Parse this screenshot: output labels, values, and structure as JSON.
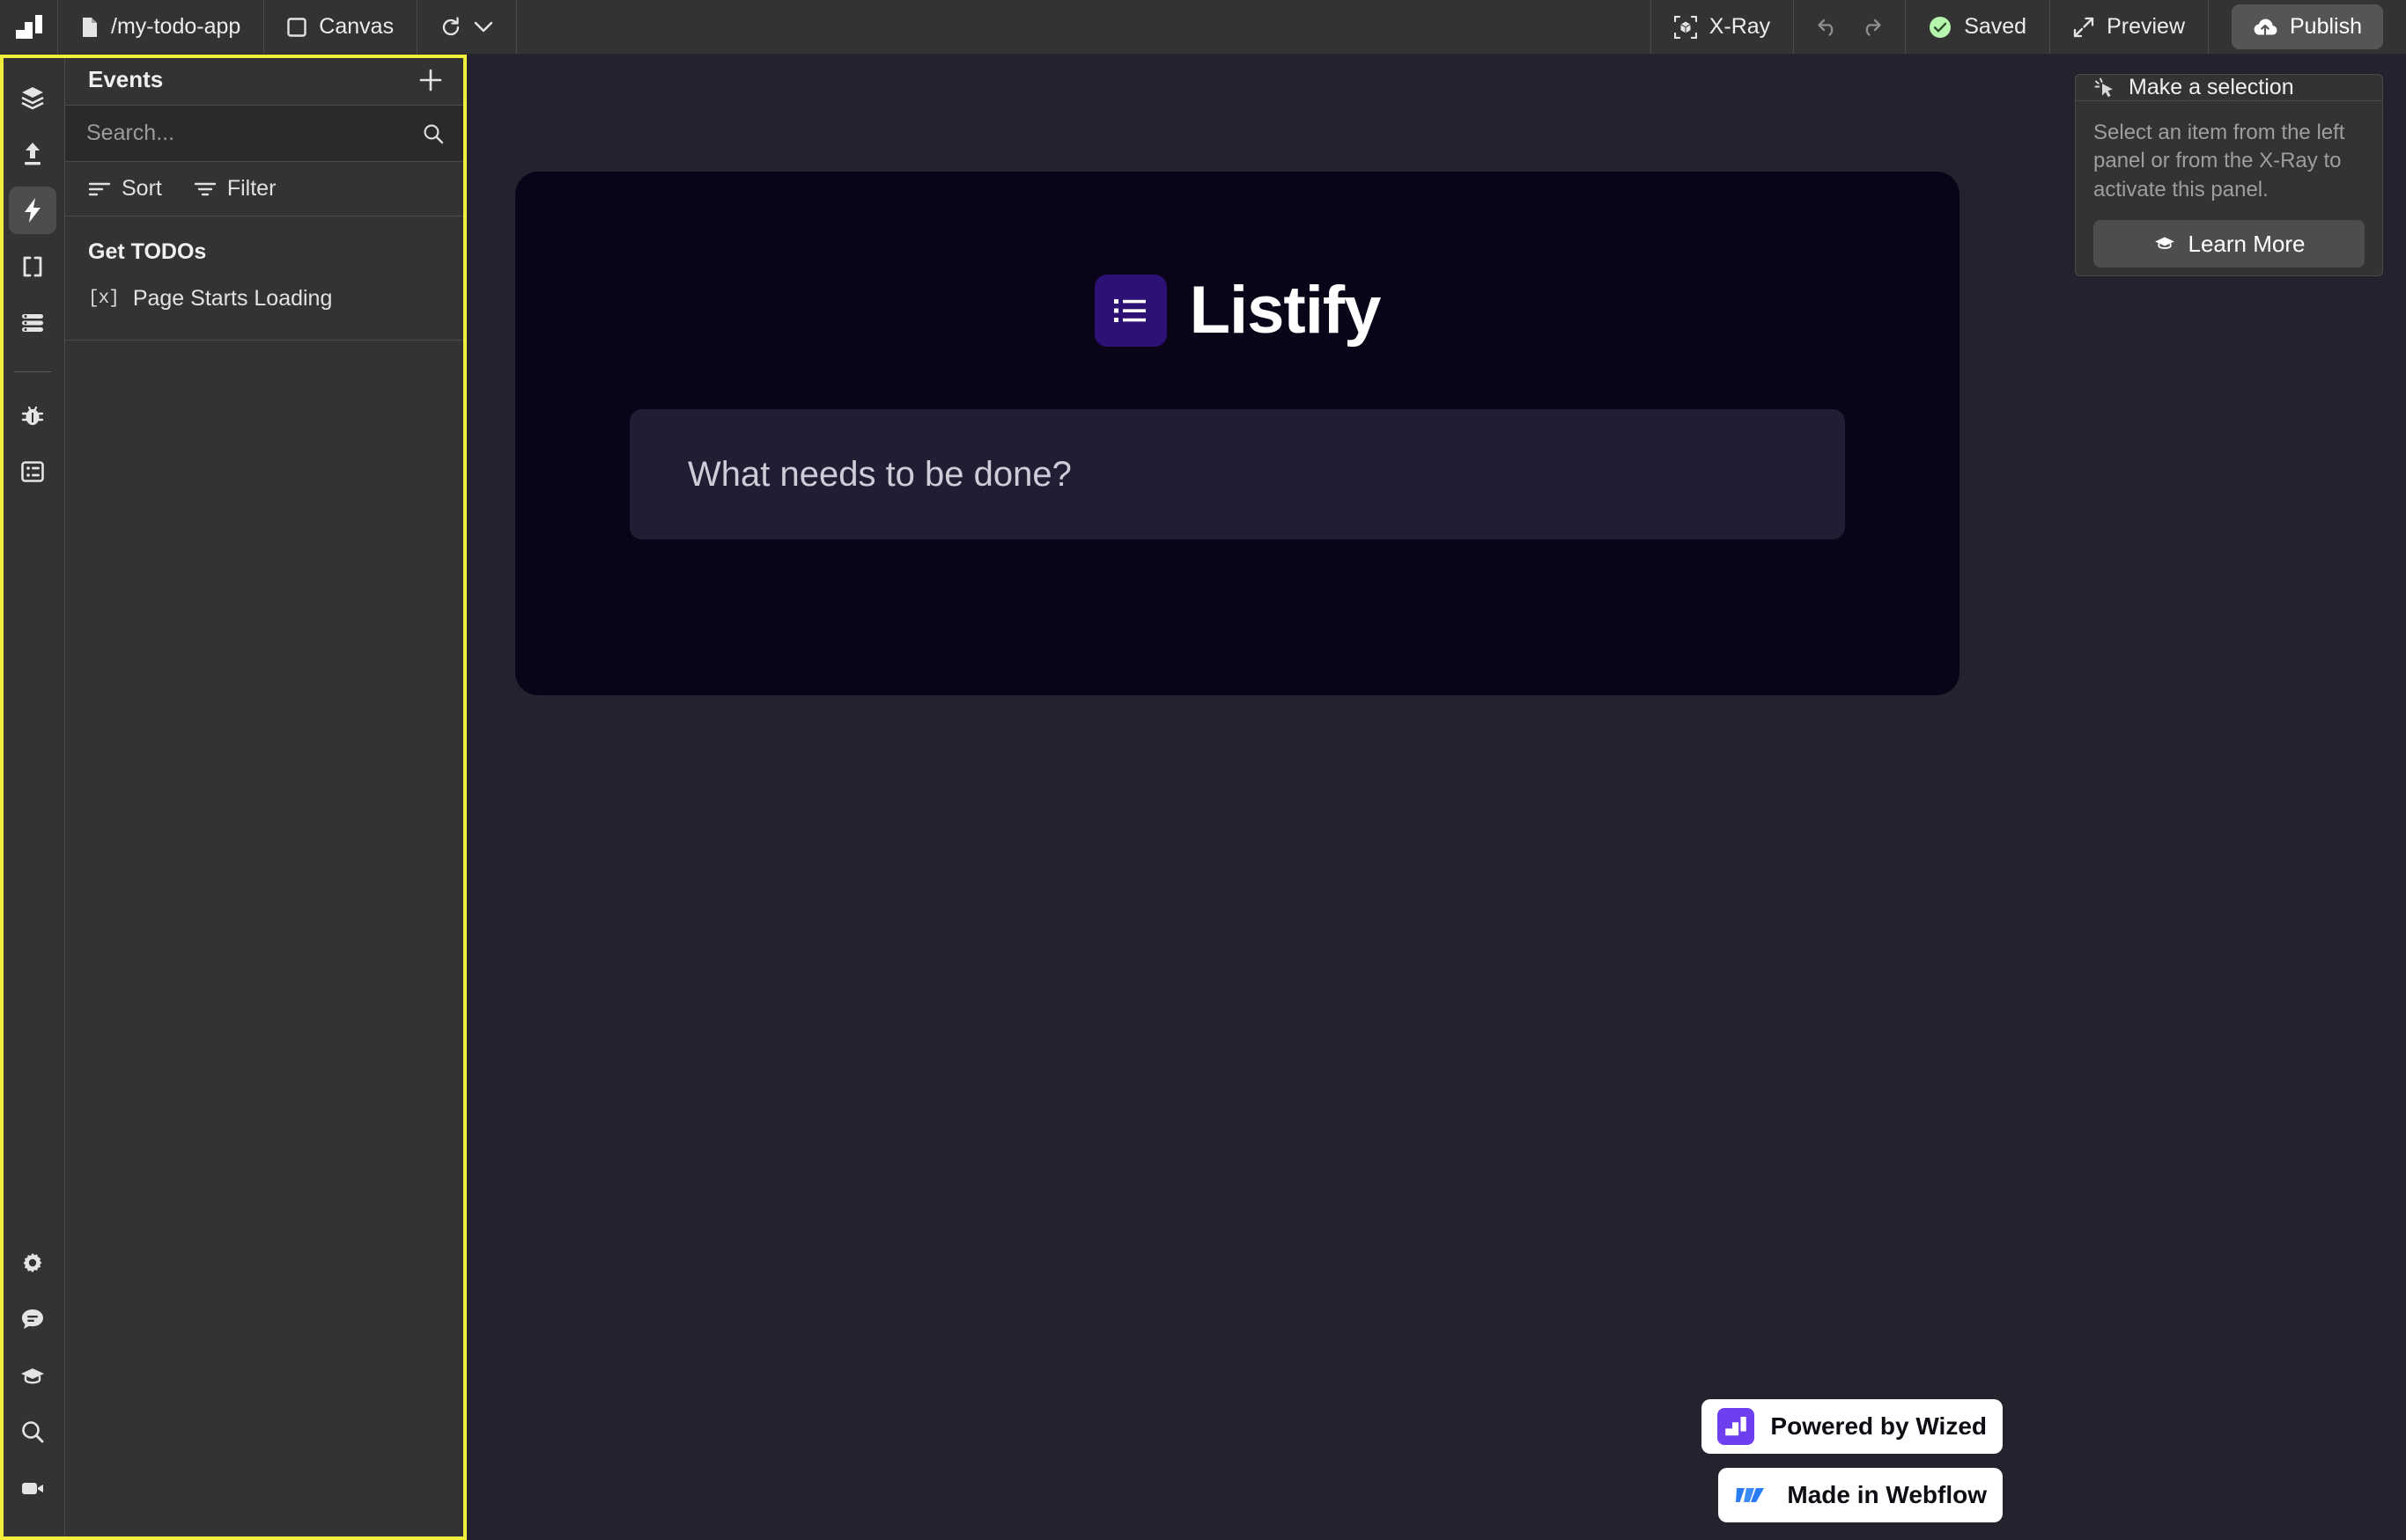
{
  "topbar": {
    "logo": "wized-logo",
    "page_name": "/my-todo-app",
    "view_name": "Canvas",
    "refresh_icon": "refresh-icon",
    "chevron_icon": "chevron-down-icon",
    "xray_label": "X-Ray",
    "undo_icon": "undo-icon",
    "redo_icon": "redo-icon",
    "save_status": "Saved",
    "preview_label": "Preview",
    "publish_label": "Publish"
  },
  "rail": {
    "items": [
      {
        "name": "layers",
        "icon": "layers-icon",
        "active": false
      },
      {
        "name": "requests",
        "icon": "upload-icon",
        "active": false
      },
      {
        "name": "events",
        "icon": "bolt-icon",
        "active": true
      },
      {
        "name": "variables",
        "icon": "brackets-icon",
        "active": false
      },
      {
        "name": "data-store",
        "icon": "list-stack-icon",
        "active": false
      },
      {
        "name": "debug",
        "icon": "bug-icon",
        "active": false
      },
      {
        "name": "logs",
        "icon": "list-detail-icon",
        "active": false
      }
    ],
    "bottom_items": [
      {
        "name": "settings",
        "icon": "gear-icon"
      },
      {
        "name": "feedback",
        "icon": "chat-icon"
      },
      {
        "name": "academy",
        "icon": "graduation-cap-icon"
      },
      {
        "name": "search",
        "icon": "search-icon"
      },
      {
        "name": "videos",
        "icon": "video-camera-icon"
      }
    ]
  },
  "events_panel": {
    "title": "Events",
    "add_icon": "plus-icon",
    "search": {
      "placeholder": "Search...",
      "value": "",
      "icon": "search-icon"
    },
    "sort_label": "Sort",
    "sort_icon": "sort-icon",
    "filter_label": "Filter",
    "filter_icon": "filter-icon",
    "groups": [
      {
        "title": "Get TODOs",
        "items": [
          {
            "icon_text": "[x]",
            "label": "Page Starts Loading"
          }
        ]
      }
    ],
    "highlight_color": "#f2ee3c"
  },
  "canvas": {
    "brand_mark_icon": "list-bullets-icon",
    "brand_name": "Listify",
    "todo_placeholder": "What needs to be done?",
    "badges": [
      {
        "icon": "wized-logo",
        "label": "Powered by Wized"
      },
      {
        "icon": "webflow-logo",
        "label": "Made in Webflow"
      }
    ],
    "accent_purple": "#2d1174",
    "card_background": "#0a0418",
    "backdrop": "#24222e"
  },
  "right_panel": {
    "header_icon": "cursor-click-icon",
    "header_title": "Make a selection",
    "body_text": "Select an item from the left panel or from the X-Ray to activate this panel.",
    "button_icon": "graduation-cap-icon",
    "button_label": "Learn More"
  }
}
